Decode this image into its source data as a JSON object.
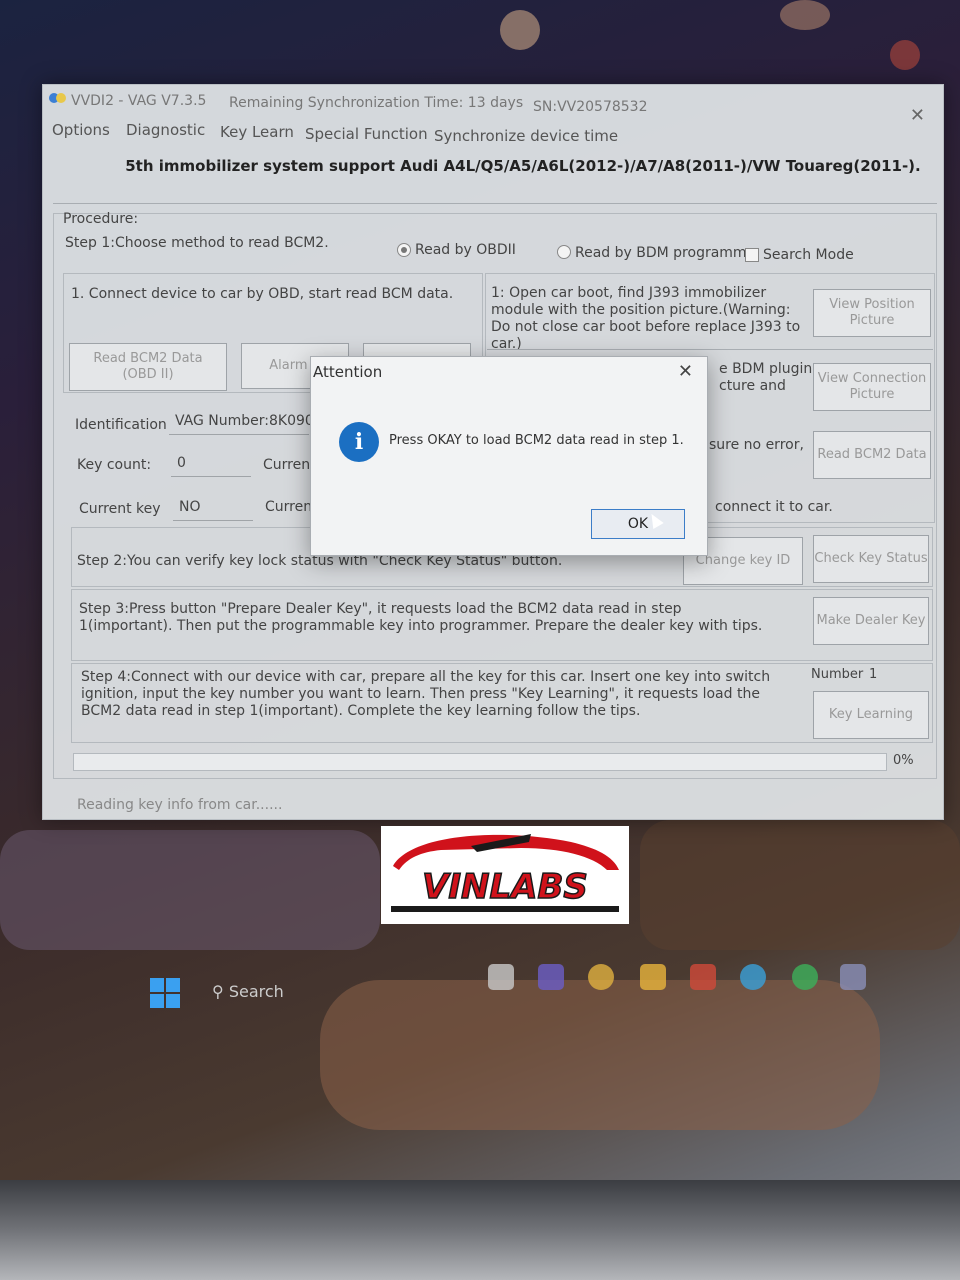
{
  "window": {
    "app_title": "VVDI2 - VAG V7.3.5",
    "sync_time": "Remaining Synchronization Time: 13 days",
    "serial": "SN:VV20578532",
    "close_glyph": "✕"
  },
  "menu": [
    "Options",
    "Diagnostic",
    "Key Learn",
    "Special Function",
    "Synchronize device time"
  ],
  "headline": "5th immobilizer system support Audi A4L/Q5/A5/A6L(2012-)/A7/A8(2011-)/VW Touareg(2011-).",
  "procedure": {
    "label": "Procedure:",
    "step1": "Step 1:Choose method to read BCM2.",
    "radio_obd": "Read by OBDII",
    "radio_bdm": "Read by BDM programm",
    "search_mode": "Search Mode",
    "connect_text": "1. Connect device to car by OBD, start read BCM data.",
    "read_bcm2_obd": "Read BCM2 Data\n(OBD II)",
    "alarm_btn": "Alarm C",
    "bdm_note1": "1: Open car boot, find J393 immobilizer module with the position picture.(Warning: Do not close car boot before replace J393 to car.)",
    "view_position": "View Position\nPicture",
    "bdm_note2": "e BDM plugin\ncture and",
    "view_connection": "View Connection\nPicture",
    "bdm_note3": "sure no error,",
    "read_bcm2_data": "Read BCM2 Data",
    "bdm_note4": "connect it to car."
  },
  "info": {
    "identification_label": "Identification",
    "identification_value": "VAG Number:8K090",
    "key_count_label": "Key count:",
    "key_count_value": "0",
    "current_label_1": "Current",
    "current_key_label": "Current key",
    "current_key_value": "NO",
    "current_label_2": "Current"
  },
  "step2": {
    "text": "Step 2:You can verify key lock status with \"Check Key Status\" button.",
    "change_key_id": "Change key ID",
    "check_key_status": "Check Key Status"
  },
  "step3": {
    "text": "Step 3:Press button \"Prepare Dealer Key\", it requests load the BCM2 data read in step 1(important). Then put the programmable key into programmer. Prepare the dealer key with tips.",
    "make_dealer_key": "Make Dealer Key"
  },
  "step4": {
    "text": "Step 4:Connect with our device with car, prepare all the key for this car. Insert one key into switch ignition, input the key number you want to learn. Then press \"Key Learning\", it requests load the BCM2 data read in step 1(important). Complete the key learning follow the tips.",
    "number_label": "Number",
    "number_value": "1",
    "key_learning": "Key Learning"
  },
  "progress": {
    "percent_label": "0%",
    "value": 0
  },
  "status_text": "Reading key info from car......",
  "dialog": {
    "title": "Attention",
    "close_glyph": "✕",
    "message": "Press OKAY to load BCM2 data read in step 1.",
    "ok_label": "OK",
    "icon": "info-icon"
  },
  "watermark": {
    "text": "VINLABS",
    "colors": {
      "red": "#d0121b",
      "black": "#1a1a1a"
    }
  },
  "taskbar": {
    "search_label": "Search"
  }
}
